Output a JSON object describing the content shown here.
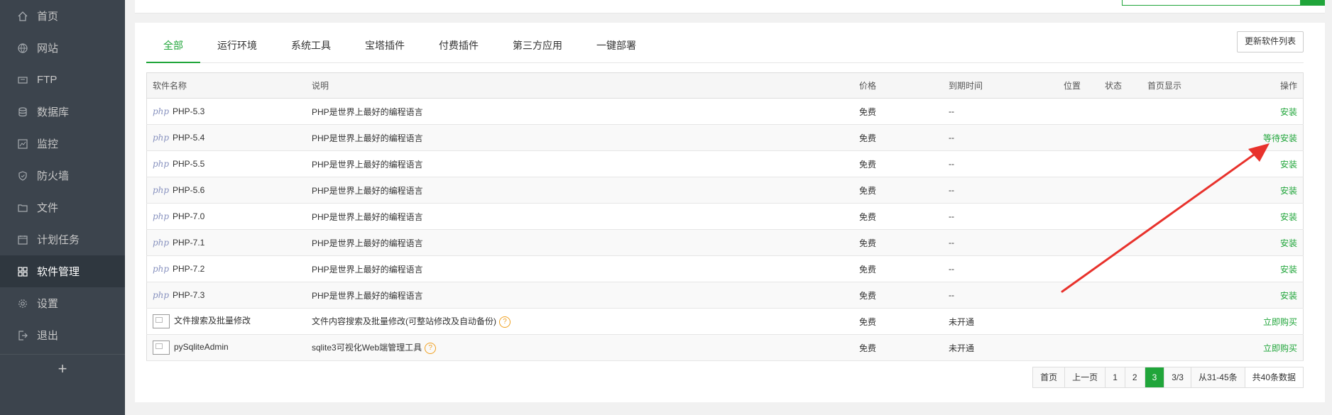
{
  "sidebar": {
    "items": [
      {
        "label": "首页",
        "icon": "home-icon"
      },
      {
        "label": "网站",
        "icon": "globe-icon"
      },
      {
        "label": "FTP",
        "icon": "ftp-icon"
      },
      {
        "label": "数据库",
        "icon": "database-icon"
      },
      {
        "label": "监控",
        "icon": "monitor-icon"
      },
      {
        "label": "防火墙",
        "icon": "shield-icon"
      },
      {
        "label": "文件",
        "icon": "folder-icon"
      },
      {
        "label": "计划任务",
        "icon": "calendar-icon"
      },
      {
        "label": "软件管理",
        "icon": "grid-icon",
        "active": true
      },
      {
        "label": "设置",
        "icon": "gear-icon"
      },
      {
        "label": "退出",
        "icon": "logout-icon"
      }
    ],
    "add_label": "+"
  },
  "tabs": [
    "全部",
    "运行环境",
    "系统工具",
    "宝塔插件",
    "付费插件",
    "第三方应用",
    "一键部署"
  ],
  "active_tab": "全部",
  "refresh_label": "更新软件列表",
  "table": {
    "headers": [
      "软件名称",
      "说明",
      "价格",
      "到期时间",
      "位置",
      "状态",
      "首页显示",
      "操作"
    ],
    "rows": [
      {
        "logo": "php",
        "name": "PHP-5.3",
        "desc": "PHP是世界上最好的编程语言",
        "price": "免费",
        "expire": "--",
        "op": "安装"
      },
      {
        "logo": "php",
        "name": "PHP-5.4",
        "desc": "PHP是世界上最好的编程语言",
        "price": "免费",
        "expire": "--",
        "op": "等待安装"
      },
      {
        "logo": "php",
        "name": "PHP-5.5",
        "desc": "PHP是世界上最好的编程语言",
        "price": "免费",
        "expire": "--",
        "op": "安装"
      },
      {
        "logo": "php",
        "name": "PHP-5.6",
        "desc": "PHP是世界上最好的编程语言",
        "price": "免费",
        "expire": "--",
        "op": "安装"
      },
      {
        "logo": "php",
        "name": "PHP-7.0",
        "desc": "PHP是世界上最好的编程语言",
        "price": "免费",
        "expire": "--",
        "op": "安装"
      },
      {
        "logo": "php",
        "name": "PHP-7.1",
        "desc": "PHP是世界上最好的编程语言",
        "price": "免费",
        "expire": "--",
        "op": "安装"
      },
      {
        "logo": "php",
        "name": "PHP-7.2",
        "desc": "PHP是世界上最好的编程语言",
        "price": "免费",
        "expire": "--",
        "op": "安装"
      },
      {
        "logo": "php",
        "name": "PHP-7.3",
        "desc": "PHP是世界上最好的编程语言",
        "price": "免费",
        "expire": "--",
        "op": "安装"
      },
      {
        "logo": "img",
        "name": "文件搜索及批量修改",
        "desc": "文件内容搜索及批量修改(可整站修改及自动备份)",
        "help": "?",
        "price": "免费",
        "expire": "未开通",
        "op": "立即购买"
      },
      {
        "logo": "img",
        "name": "pySqliteAdmin",
        "desc": "sqlite3可视化Web端管理工具",
        "help": "?",
        "price": "免费",
        "expire": "未开通",
        "op": "立即购买"
      }
    ]
  },
  "php_logo_text": "php",
  "pager": {
    "first": "首页",
    "prev": "上一页",
    "pages": [
      "1",
      "2",
      "3"
    ],
    "current": "3",
    "page_of": "3/3",
    "range": "从31-45条",
    "total": "共40条数据"
  },
  "colors": {
    "accent": "#20a53a",
    "sidebar": "#3c444d",
    "arrow": "#e8322c"
  }
}
